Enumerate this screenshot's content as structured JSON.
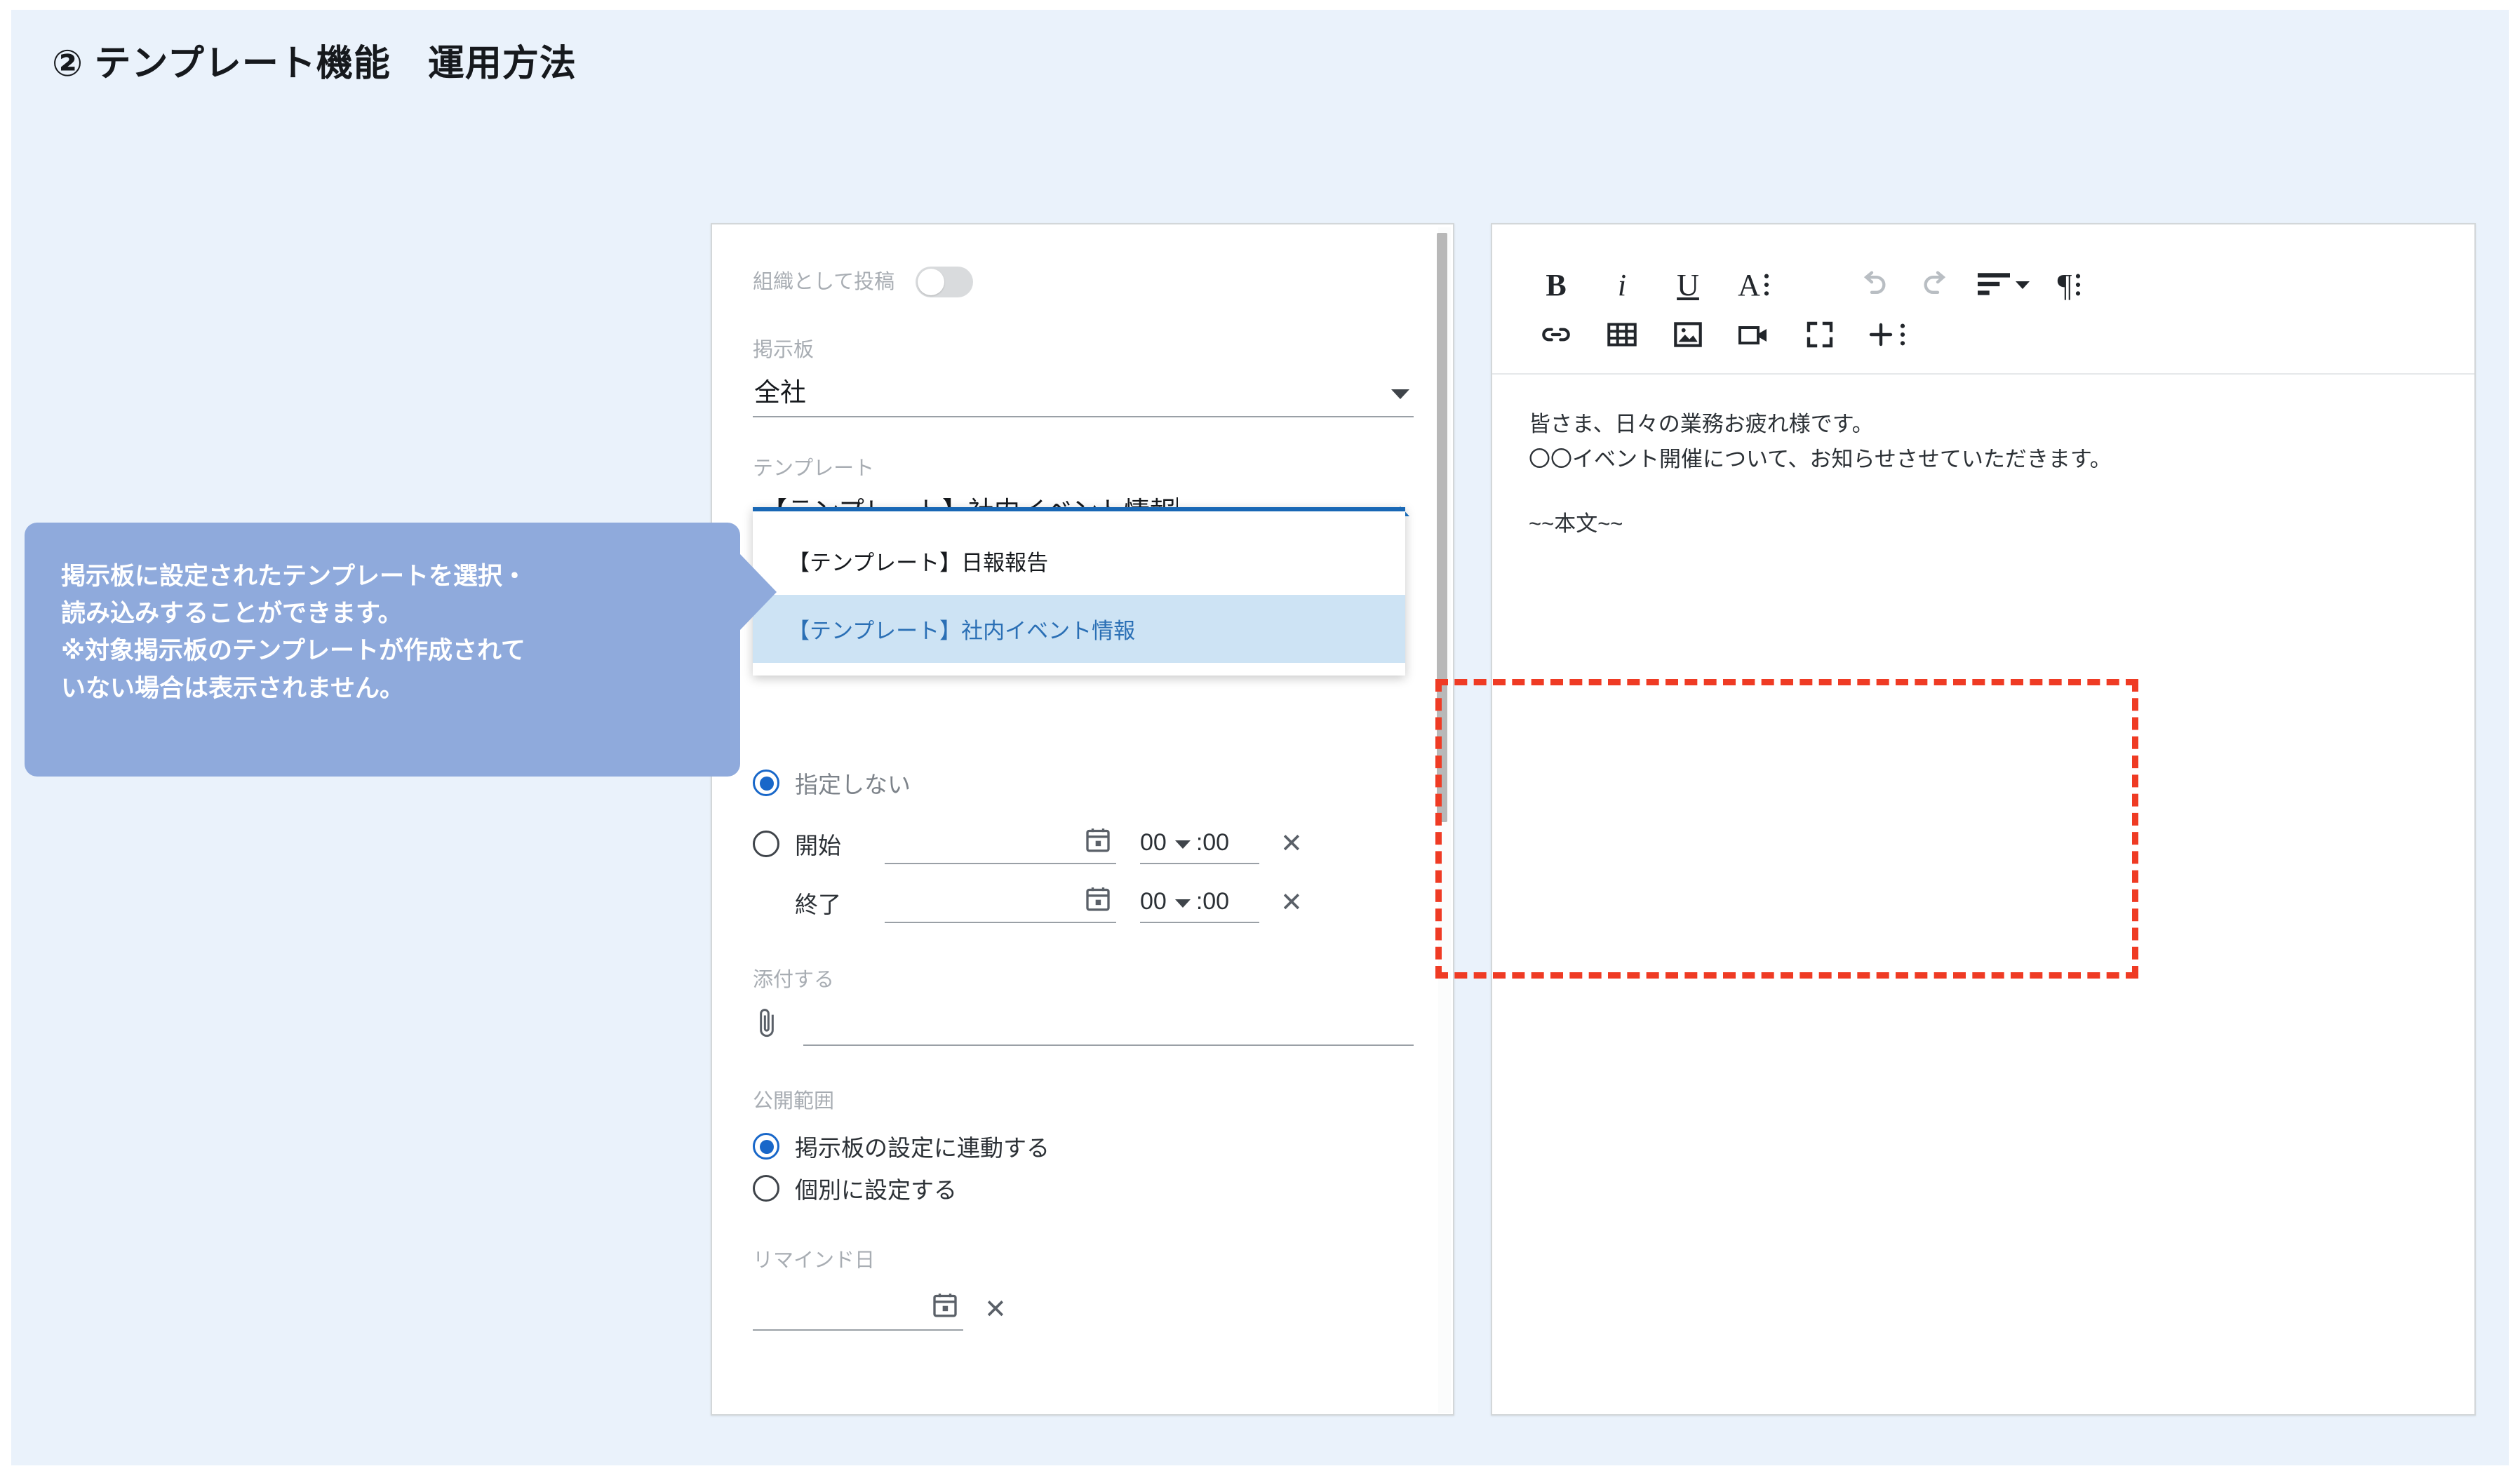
{
  "page": {
    "title": "② テンプレート機能　運用方法",
    "background_color": "#eaf2fb"
  },
  "callout": {
    "text": "掲示板に設定されたテンプレートを選択・\n読み込みすることができます。\n※対象掲示板のテンプレートが作成されて\nいない場合は表示されません。",
    "background_color": "#8faadc",
    "text_color": "#ffffff"
  },
  "highlight": {
    "color": "#ef3b24",
    "style": "dashed"
  },
  "form": {
    "post_as_org": {
      "label": "組織として投稿",
      "toggle_state": "off"
    },
    "board": {
      "label": "掲示板",
      "value": "全社",
      "caret_icon": "chevron-down-icon"
    },
    "template": {
      "label": "テンプレート",
      "value": "【テンプレート】社内イベント情報",
      "caret_icon": "chevron-up-icon",
      "expanded": true,
      "options": [
        {
          "label": "【テンプレート】日報報告",
          "selected": false
        },
        {
          "label": "【テンプレート】社内イベント情報",
          "selected": true
        }
      ]
    },
    "schedule": {
      "no_specify": {
        "label": "指定しない",
        "selected": true
      },
      "start": {
        "label": "開始",
        "selected": false,
        "date_value": "",
        "hour": "00",
        "minute_suffix": ":00",
        "calendar_icon": "calendar-icon",
        "clear_icon": "close-icon"
      },
      "end": {
        "label": "終了",
        "date_value": "",
        "hour": "00",
        "minute_suffix": ":00",
        "calendar_icon": "calendar-icon",
        "clear_icon": "close-icon"
      }
    },
    "attachment": {
      "label": "添付する",
      "icon": "paperclip-icon",
      "value": ""
    },
    "scope": {
      "label": "公開範囲",
      "options": [
        {
          "label": "掲示板の設定に連動する",
          "selected": true
        },
        {
          "label": "個別に設定する",
          "selected": false
        }
      ]
    },
    "remind": {
      "label": "リマインド日",
      "date_value": "",
      "calendar_icon": "calendar-icon",
      "clear_icon": "close-icon"
    }
  },
  "editor": {
    "toolbar_row1": [
      {
        "name": "bold-icon",
        "glyph": "B"
      },
      {
        "name": "italic-icon",
        "glyph": "i"
      },
      {
        "name": "underline-icon",
        "glyph": "U"
      },
      {
        "name": "font-style-icon",
        "glyph": "A"
      },
      {
        "name": "undo-icon",
        "glyph": "↶"
      },
      {
        "name": "redo-icon",
        "glyph": "↷"
      },
      {
        "name": "align-left-icon",
        "glyph": "≡"
      },
      {
        "name": "paragraph-icon",
        "glyph": "¶"
      }
    ],
    "toolbar_row2": [
      {
        "name": "link-icon",
        "glyph": "🔗"
      },
      {
        "name": "table-icon",
        "glyph": "▦"
      },
      {
        "name": "image-icon",
        "glyph": "🖼"
      },
      {
        "name": "video-icon",
        "glyph": "▭"
      },
      {
        "name": "fullscreen-icon",
        "glyph": "⛶"
      },
      {
        "name": "add-icon",
        "glyph": "+"
      }
    ],
    "body": {
      "line1": "皆さま、日々の業務お疲れ様です。",
      "line2": "〇〇イベント開催について、お知らせさせていただきます。",
      "line3": "~~本文~~"
    }
  }
}
